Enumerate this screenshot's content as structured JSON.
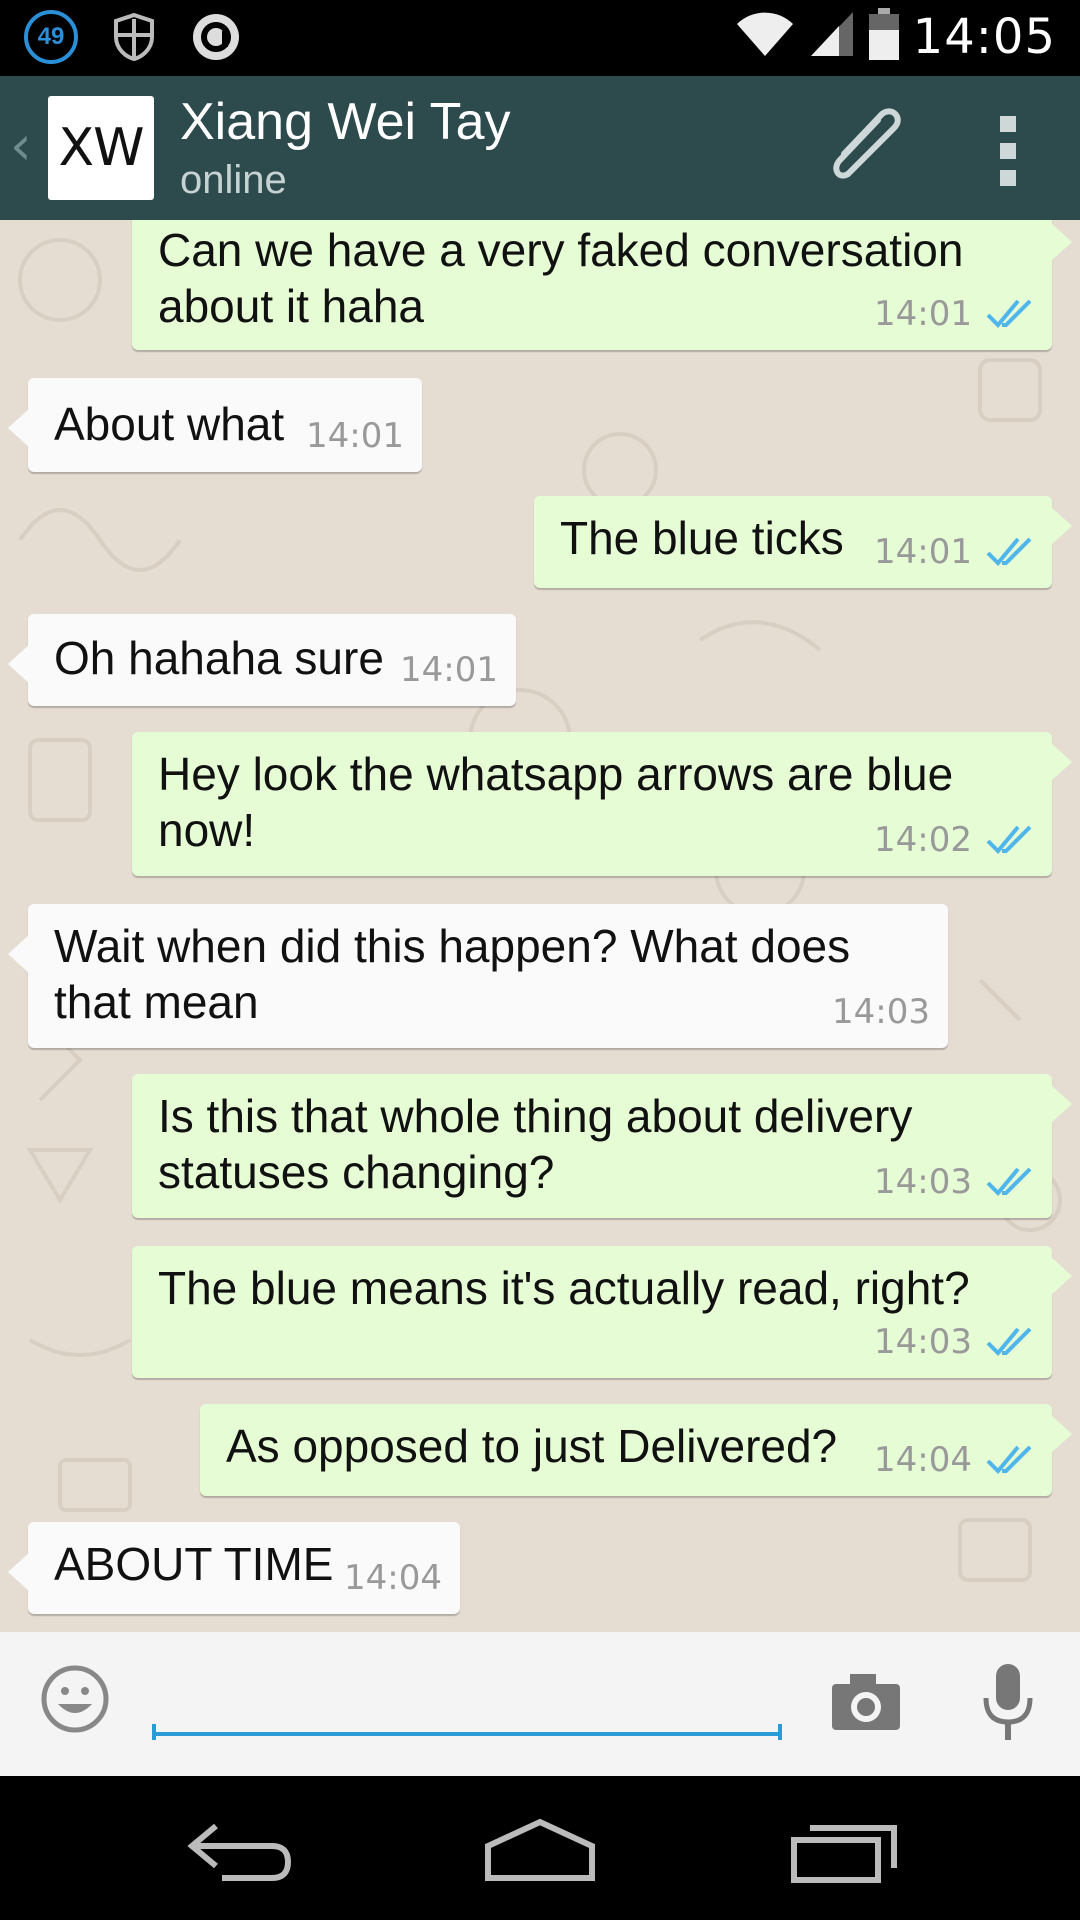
{
  "status_bar": {
    "notification_count": "49",
    "time": "14:05"
  },
  "header": {
    "avatar_initials": "XW",
    "contact_name": "Xiang Wei Tay",
    "contact_status": "online"
  },
  "messages": [
    {
      "direction": "out",
      "text_lines": [
        "Can we have a very faked conversation",
        "about it haha"
      ],
      "time": "14:01",
      "ticks": "read"
    },
    {
      "direction": "in",
      "text_lines": [
        "About what"
      ],
      "time": "14:01"
    },
    {
      "direction": "out",
      "text_lines": [
        "The blue ticks"
      ],
      "time": "14:01",
      "ticks": "read"
    },
    {
      "direction": "in",
      "text_lines": [
        "Oh hahaha sure"
      ],
      "time": "14:01"
    },
    {
      "direction": "out",
      "text_lines": [
        "Hey look the whatsapp arrows are blue",
        "now!"
      ],
      "time": "14:02",
      "ticks": "read"
    },
    {
      "direction": "in",
      "text_lines": [
        "Wait when did this happen? What does",
        "that mean"
      ],
      "time": "14:03"
    },
    {
      "direction": "out",
      "text_lines": [
        "Is this that whole thing about delivery",
        "statuses changing?"
      ],
      "time": "14:03",
      "ticks": "read"
    },
    {
      "direction": "out",
      "text_lines": [
        "The blue means it's actually read, right?"
      ],
      "time": "14:03",
      "ticks": "read"
    },
    {
      "direction": "out",
      "text_lines": [
        "As opposed to just Delivered?"
      ],
      "time": "14:04",
      "ticks": "read"
    },
    {
      "direction": "in",
      "text_lines": [
        "ABOUT TIME"
      ],
      "time": "14:04"
    }
  ],
  "input": {
    "value": "",
    "placeholder": ""
  },
  "colors": {
    "header_bg": "#2d4a4d",
    "outgoing_bubble": "#e5fcd5",
    "incoming_bubble": "#fafafa",
    "read_ticks": "#4fb6ec",
    "chat_bg": "#e5ddd2"
  },
  "icons": [
    "wifi-icon",
    "signal-icon",
    "battery-icon",
    "attach-icon",
    "menu-icon",
    "emoji-icon",
    "camera-icon",
    "mic-icon",
    "nav-back-icon",
    "nav-home-icon",
    "nav-recents-icon"
  ]
}
